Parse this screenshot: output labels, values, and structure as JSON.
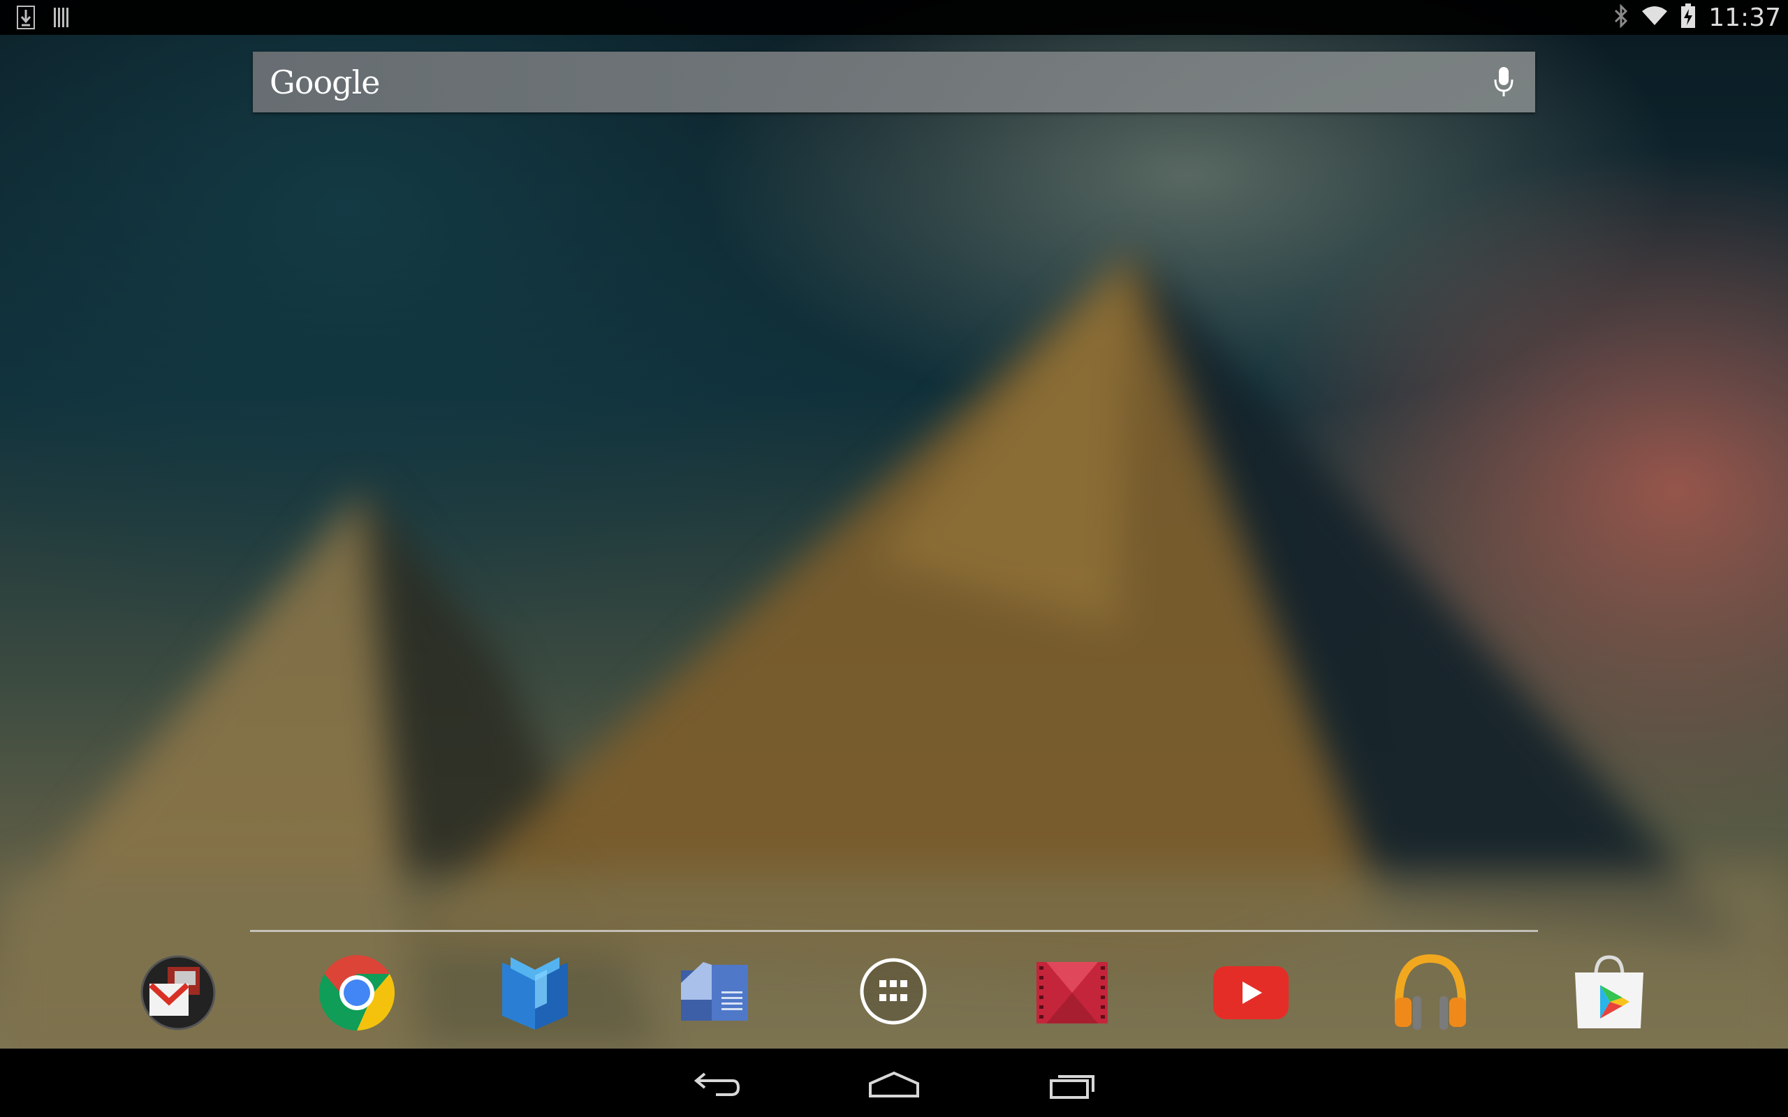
{
  "status_bar": {
    "left_icons": [
      "download-icon",
      "barcode-icon"
    ],
    "right_icons": [
      "bluetooth-icon",
      "wifi-icon",
      "battery-charging-icon"
    ],
    "time": "11:37"
  },
  "search": {
    "logo_text": "Google",
    "mic_icon": "microphone-icon"
  },
  "dock": {
    "apps": [
      {
        "name": "gmail-app-icon"
      },
      {
        "name": "chrome-app-icon"
      },
      {
        "name": "play-books-app-icon"
      },
      {
        "name": "play-newsstand-app-icon"
      },
      {
        "name": "all-apps-icon"
      },
      {
        "name": "play-movies-app-icon"
      },
      {
        "name": "youtube-app-icon"
      },
      {
        "name": "play-music-app-icon"
      },
      {
        "name": "play-store-app-icon"
      }
    ]
  },
  "nav_bar": {
    "buttons": [
      "back-icon",
      "home-icon",
      "recents-icon"
    ]
  },
  "colors": {
    "status_bar_bg": "#000000",
    "search_bar_bg": "#6e7276",
    "youtube_red": "#e52d27",
    "chrome_red": "#db4437",
    "chrome_yellow": "#f4c20d",
    "chrome_green": "#0f9d58",
    "chrome_blue": "#4285f4"
  }
}
